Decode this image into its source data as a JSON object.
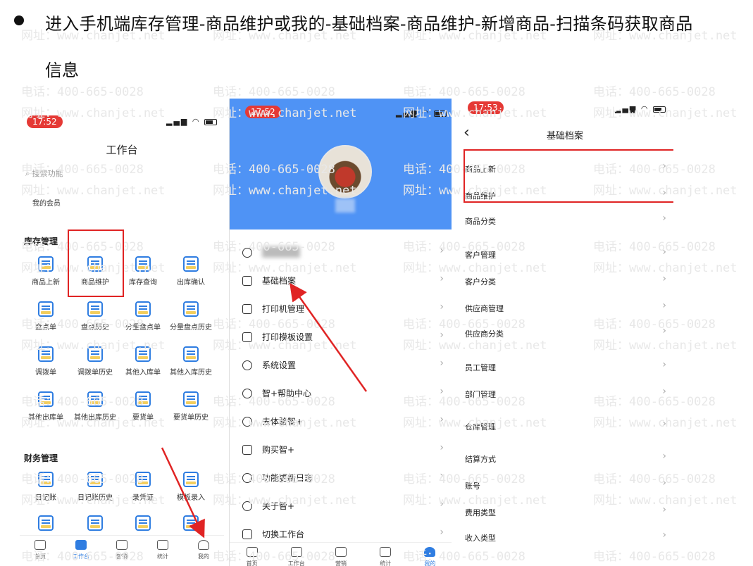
{
  "slide": {
    "heading_line1": "进入手机端库存管理-商品维护或我的-基础档案-商品维护-新增商品-扫描条码获取商品",
    "heading_line2": "信息",
    "watermark_url": "网址：www.chanjet.net",
    "watermark_phone": "电话：400-665-0028"
  },
  "colors": {
    "accent": "#2f7de1",
    "highlight": "#e02424",
    "profile_bg": "#4f93f5",
    "time_pill": "#e53935"
  },
  "screen1": {
    "time": "17:52",
    "title": "工作台",
    "search_placeholder": "搜索功能",
    "member": "我的会员",
    "inventory_section": "库存管理",
    "inventory_items": [
      {
        "label": "商品上新",
        "icon": "new-product-icon"
      },
      {
        "label": "商品维护",
        "icon": "product-maintenance-icon"
      },
      {
        "label": "库存查询",
        "icon": "inventory-query-icon"
      },
      {
        "label": "出库确认",
        "icon": "outbound-confirm-icon"
      },
      {
        "label": "盘点单",
        "icon": "stocktake-icon"
      },
      {
        "label": "盘点历史",
        "icon": "stocktake-history-icon"
      },
      {
        "label": "分量盘点单",
        "icon": "partial-stocktake-icon"
      },
      {
        "label": "分量盘点历史",
        "icon": "partial-stocktake-history-icon"
      },
      {
        "label": "调拨单",
        "icon": "transfer-icon"
      },
      {
        "label": "调拨单历史",
        "icon": "transfer-history-icon"
      },
      {
        "label": "其他入库单",
        "icon": "other-inbound-icon"
      },
      {
        "label": "其他入库历史",
        "icon": "other-inbound-history-icon"
      },
      {
        "label": "其他出库单",
        "icon": "other-outbound-icon"
      },
      {
        "label": "其他出库历史",
        "icon": "other-outbound-history-icon"
      },
      {
        "label": "要货单",
        "icon": "requisition-icon"
      },
      {
        "label": "要货单历史",
        "icon": "requisition-history-icon"
      }
    ],
    "finance_section": "财务管理",
    "finance_items": [
      {
        "label": "日记账",
        "icon": "journal-icon"
      },
      {
        "label": "日记账历史",
        "icon": "journal-history-icon"
      },
      {
        "label": "录凭证",
        "icon": "voucher-icon"
      },
      {
        "label": "模板录入",
        "icon": "template-entry-icon"
      }
    ],
    "tabs": [
      {
        "label": "首页",
        "icon": "home-icon"
      },
      {
        "label": "工作台",
        "icon": "workbench-icon"
      },
      {
        "label": "营销",
        "icon": "marketing-icon"
      },
      {
        "label": "统计",
        "icon": "statistics-icon"
      },
      {
        "label": "我的",
        "icon": "profile-icon"
      }
    ]
  },
  "screen2": {
    "time": "17:52",
    "menu": [
      {
        "label": "",
        "icon": "user-icon"
      },
      {
        "label": "基础档案",
        "icon": "document-icon"
      },
      {
        "label": "打印机管理",
        "icon": "printer-icon"
      },
      {
        "label": "打印模板设置",
        "icon": "print-template-icon"
      },
      {
        "label": "系统设置",
        "icon": "settings-icon"
      },
      {
        "label": "智+帮助中心",
        "icon": "help-icon"
      },
      {
        "label": "去体验智+",
        "icon": "experience-icon"
      },
      {
        "label": "购买智+",
        "icon": "cart-icon"
      },
      {
        "label": "功能更新日志",
        "icon": "changelog-icon"
      },
      {
        "label": "关于智+",
        "icon": "info-icon"
      },
      {
        "label": "切换工作台",
        "icon": "switch-icon"
      }
    ],
    "tabs": [
      {
        "label": "首页",
        "icon": "home-icon"
      },
      {
        "label": "工作台",
        "icon": "workbench-icon"
      },
      {
        "label": "营销",
        "icon": "marketing-icon"
      },
      {
        "label": "统计",
        "icon": "statistics-icon"
      },
      {
        "label": "我的",
        "icon": "profile-icon"
      }
    ]
  },
  "screen3": {
    "time": "17:53",
    "title": "基础档案",
    "rows": [
      "商品上新",
      "商品维护",
      "商品分类",
      "客户管理",
      "客户分类",
      "供应商管理",
      "供应商分类",
      "员工管理",
      "部门管理",
      "仓库管理",
      "结算方式",
      "账号",
      "费用类型",
      "收入类型"
    ]
  }
}
